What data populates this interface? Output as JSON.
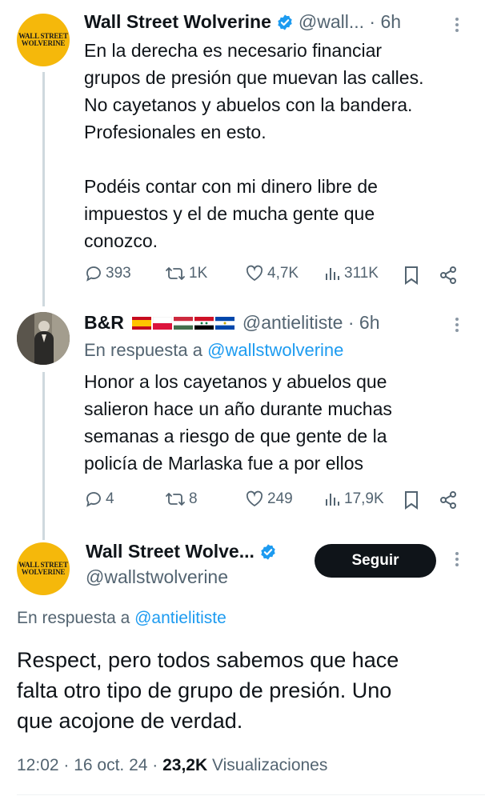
{
  "tweet1": {
    "avatar_text": [
      "WALL STREET",
      "WOLVERINE"
    ],
    "name": "Wall Street Wolverine",
    "handle_time": "@wall... · 6h",
    "text": "En la derecha es necesario financiar\ngrupos de presión que muevan las calles.\nNo cayetanos y abuelos con la bandera.\nProfesionales en esto.\n\nPodéis contar con mi dinero libre de\nimpuestos y el de mucha gente que\nconozco.",
    "replies": "393",
    "retweets": "1K",
    "likes": "4,7K",
    "views": "311K"
  },
  "tweet2": {
    "name": "B&R",
    "flags": [
      "spain-flag",
      "poland-flag",
      "hungary-flag",
      "syria-flag",
      "el-salvador-flag"
    ],
    "handle_time": "@antielitiste · 6h",
    "reply_prefix": "En respuesta a",
    "reply_handle": "@wallstwolverine",
    "text": "Honor a los cayetanos y abuelos que\nsalieron hace un año durante muchas\nsemanas a riesgo de que gente de la\npolicía de Marlaska fue a por ellos",
    "replies": "4",
    "retweets": "8",
    "likes": "249",
    "views": "17,9K"
  },
  "main_tweet": {
    "avatar_text": [
      "WALL STREET",
      "WOLVERINE"
    ],
    "name": "Wall Street Wolve...",
    "handle": "@wallstwolverine",
    "follow_label": "Seguir",
    "reply_prefix": "En respuesta a",
    "reply_handle": "@antielitiste",
    "text": "Respect, pero todos sabemos que hace\nfalta otro tipo de grupo de presión. Uno\nque acojone de verdad.",
    "time_date": "12:02 · 16 oct. 24 · ",
    "views_count": "23,2K",
    "views_label": " Visualizaciones"
  },
  "colors": {
    "accent": "#1d9bf0",
    "muted": "#536471",
    "avatar": "#f5b80b"
  }
}
